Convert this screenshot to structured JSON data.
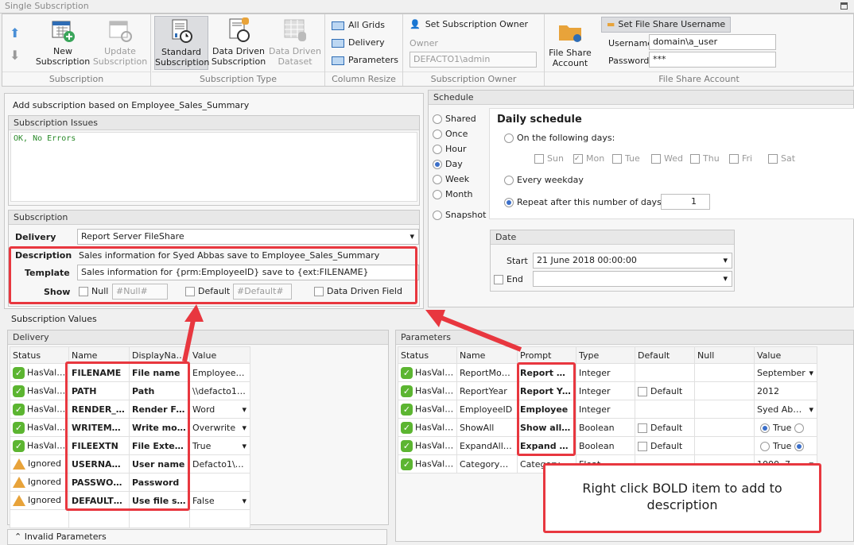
{
  "window": {
    "title": "Single Subscription"
  },
  "ribbon": {
    "subscription": {
      "label": "Subscription",
      "new": "New Subscription",
      "update": "Update Subscription"
    },
    "type": {
      "label": "Subscription Type",
      "standard": "Standard Subscription",
      "data_driven": "Data Driven Subscription",
      "data_driven_dataset": "Data Driven Dataset"
    },
    "column_resize": {
      "label": "Column Resize",
      "items": [
        "All Grids",
        "Delivery",
        "Parameters"
      ]
    },
    "owner": {
      "label": "Subscription Owner",
      "set": "Set Subscription Owner",
      "owner_label": "Owner",
      "owner_value": "DEFACTO1\\admin"
    },
    "fileshare": {
      "label": "File Share Account",
      "account": "File Share Account",
      "set_username": "Set File Share Username",
      "username_label": "Username",
      "username_value": "domain\\a_user",
      "password_label": "Password",
      "password_value": "***"
    }
  },
  "left": {
    "header": "Add subscription based on Employee_Sales_Summary",
    "issues": {
      "title": "Subscription Issues",
      "text": "OK, No Errors"
    },
    "subscription": {
      "title": "Subscription",
      "delivery_label": "Delivery",
      "delivery_value": "Report Server FileShare",
      "description_label": "Description",
      "description_value": "Sales information for Syed Abbas save to Employee_Sales_Summary",
      "template_label": "Template",
      "template_value": "Sales information for {prm:EmployeeID} save to {ext:FILENAME}",
      "show_label": "Show",
      "null_label": "Null",
      "null_placeholder": "#Null#",
      "default_label": "Default",
      "default_placeholder": "#Default#",
      "ddf_label": "Data Driven Field"
    }
  },
  "schedule": {
    "title": "Schedule",
    "options": [
      "Shared",
      "Once",
      "Hour",
      "Day",
      "Week",
      "Month",
      "Snapshot"
    ],
    "selected": "Day",
    "daily_title": "Daily schedule",
    "on_days": "On the following days:",
    "days": [
      {
        "d": "Sun",
        "c": false
      },
      {
        "d": "Mon",
        "c": true
      },
      {
        "d": "Tue",
        "c": false
      },
      {
        "d": "Wed",
        "c": false
      },
      {
        "d": "Thu",
        "c": false
      },
      {
        "d": "Fri",
        "c": false
      },
      {
        "d": "Sat",
        "c": false
      }
    ],
    "every_weekday": "Every weekday",
    "repeat": "Repeat after this number of days",
    "repeat_value": "1",
    "date": {
      "title": "Date",
      "start_label": "Start",
      "start_value": "21 June 2018 00:00:00",
      "end_label": "End"
    }
  },
  "values": {
    "title": "Subscription Values",
    "delivery": {
      "title": "Delivery",
      "columns": [
        "Status",
        "Name",
        "DisplayName",
        "Value"
      ],
      "rows": [
        {
          "status": "HasVali…",
          "ok": true,
          "name": "FILENAME",
          "display": "File name",
          "value": "Employee_…",
          "dd": false
        },
        {
          "status": "HasVali…",
          "ok": true,
          "name": "PATH",
          "display": "Path",
          "value": "\\\\defacto1…",
          "dd": false
        },
        {
          "status": "HasVali…",
          "ok": true,
          "name": "RENDER_…",
          "display": "Render Fo…",
          "value": "Word",
          "dd": true
        },
        {
          "status": "HasVali…",
          "ok": true,
          "name": "WRITEMO…",
          "display": "Write mode",
          "value": "Overwrite",
          "dd": true
        },
        {
          "status": "HasVali…",
          "ok": true,
          "name": "FILEEXTN",
          "display": "File Exten…",
          "value": "True",
          "dd": true
        },
        {
          "status": "Ignored",
          "ok": false,
          "name": "USERNAME",
          "display": "User name",
          "value": "Defacto1\\a…",
          "dd": false
        },
        {
          "status": "Ignored",
          "ok": false,
          "name": "PASSWORD",
          "display": "Password",
          "value": "",
          "dd": false
        },
        {
          "status": "Ignored",
          "ok": false,
          "name": "DEFAULTC…",
          "display": "Use file sh…",
          "value": "False",
          "dd": true
        }
      ]
    },
    "parameters": {
      "title": "Parameters",
      "columns": [
        "Status",
        "Name",
        "Prompt",
        "Type",
        "Default",
        "Null",
        "Value"
      ],
      "rows": [
        {
          "status": "HasVali…",
          "name": "ReportMonth",
          "prompt": "Report M…",
          "bold": true,
          "type": "Integer",
          "default": "",
          "value": "September",
          "kind": "dd"
        },
        {
          "status": "HasVali…",
          "name": "ReportYear",
          "prompt": "Report Ye…",
          "bold": true,
          "type": "Integer",
          "default": "Default",
          "value": "2012",
          "kind": "text"
        },
        {
          "status": "HasVali…",
          "name": "EmployeeID",
          "prompt": "Employee",
          "bold": true,
          "type": "Integer",
          "default": "",
          "value": "Syed Ab…",
          "kind": "dd"
        },
        {
          "status": "HasVali…",
          "name": "ShowAll",
          "prompt": "Show all i…",
          "bold": true,
          "type": "Boolean",
          "default": "Default",
          "value": "True",
          "kind": "radio-true"
        },
        {
          "status": "HasVali…",
          "name": "ExpandAllT…",
          "prompt": "Expand all…",
          "bold": true,
          "type": "Boolean",
          "default": "Default",
          "value": "True",
          "kind": "radio-false"
        },
        {
          "status": "HasVali…",
          "name": "CategoryQ…",
          "prompt": "Category q…",
          "bold": false,
          "type": "Float",
          "default": "",
          "value": "1000, 7…",
          "kind": "dd"
        }
      ]
    },
    "invalid": "Invalid Parameters"
  },
  "annotation": {
    "text": "Right click BOLD item to add to description",
    "color": "#e8373f"
  }
}
